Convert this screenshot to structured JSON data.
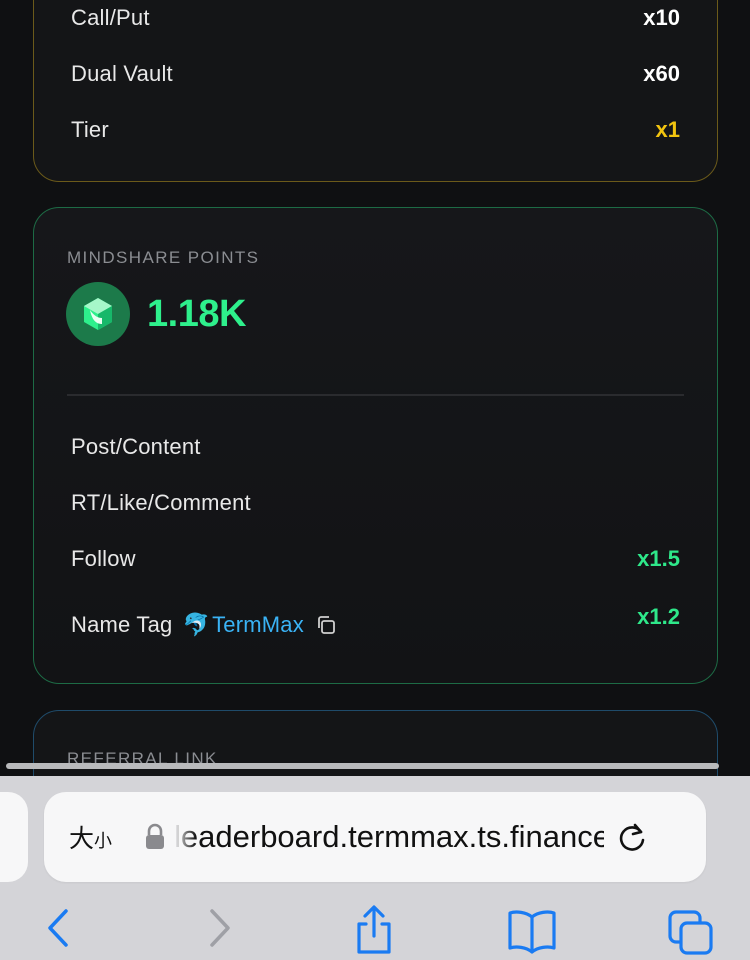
{
  "card_top": {
    "rows": [
      {
        "label": "Call/Put",
        "multiplier": "x10"
      },
      {
        "label": "Dual Vault",
        "multiplier": "x60"
      },
      {
        "label": "Tier",
        "multiplier": "x1"
      }
    ]
  },
  "mindshare": {
    "title": "MINDSHARE POINTS",
    "points": "1.18K",
    "rows": [
      {
        "label": "Post/Content",
        "multiplier": ""
      },
      {
        "label": "RT/Like/Comment",
        "multiplier": ""
      },
      {
        "label": "Follow",
        "multiplier": "x1.5"
      }
    ],
    "name_tag": {
      "label": "Name Tag",
      "emoji": "🐬",
      "tag": "TermMax",
      "multiplier": "x1.2"
    }
  },
  "referral": {
    "title": "REFERRAL LINK"
  },
  "browser": {
    "text_size_big": "大",
    "text_size_small": "小",
    "url": "leaderboard.termmax.ts.finance"
  },
  "colors": {
    "accent_green": "#2ef08c",
    "accent_gold": "#f2c40f",
    "link_blue": "#3ab3f5",
    "ios_blue": "#1a7bf2"
  },
  "icons": [
    "termmax-logo-icon",
    "copy-icon",
    "lock-icon",
    "reload-icon",
    "back-icon",
    "forward-icon",
    "share-icon",
    "bookmarks-icon",
    "tabs-icon"
  ]
}
